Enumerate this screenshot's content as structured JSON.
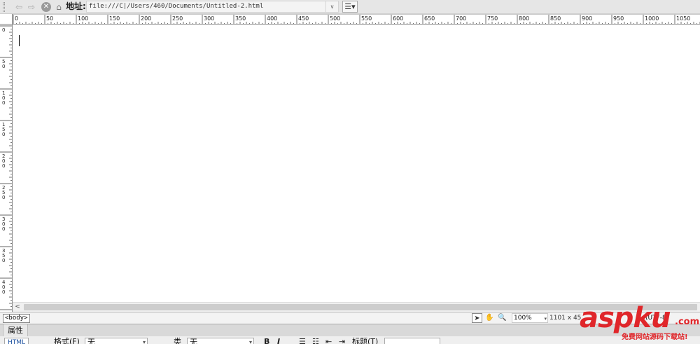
{
  "address_bar": {
    "back_icon": "back-arrow-icon",
    "forward_icon": "forward-arrow-icon",
    "stop_icon": "stop-icon",
    "home_icon": "home-icon",
    "label": "地址:",
    "url": "file:///C|/Users/460/Documents/Untitled-2.html",
    "options_icon": "page-options-icon"
  },
  "rulers": {
    "horizontal_labels": [
      "0",
      "50",
      "100",
      "150",
      "200",
      "250",
      "300",
      "350",
      "400",
      "450",
      "500",
      "550",
      "600",
      "650",
      "700",
      "750",
      "800",
      "850",
      "900",
      "950",
      "1000",
      "1050"
    ],
    "vertical_labels": [
      "0",
      "50",
      "100",
      "150",
      "200",
      "250",
      "300",
      "350",
      "400"
    ]
  },
  "status_bar": {
    "tag": "<body>",
    "zoom": "100%",
    "dimensions": "1101 x 45",
    "encoding": "(UTF-8)"
  },
  "properties": {
    "tab": "属性",
    "html_button": "HTML",
    "format_label": "格式(F)",
    "format_value": "无",
    "class_label": "类",
    "class_value": "无",
    "bold": "B",
    "italic": "I",
    "title_label": "标题(T)"
  },
  "watermark": {
    "brand": "aspku",
    "tld": ".com",
    "subtitle": "免费网站源码下载站!"
  }
}
